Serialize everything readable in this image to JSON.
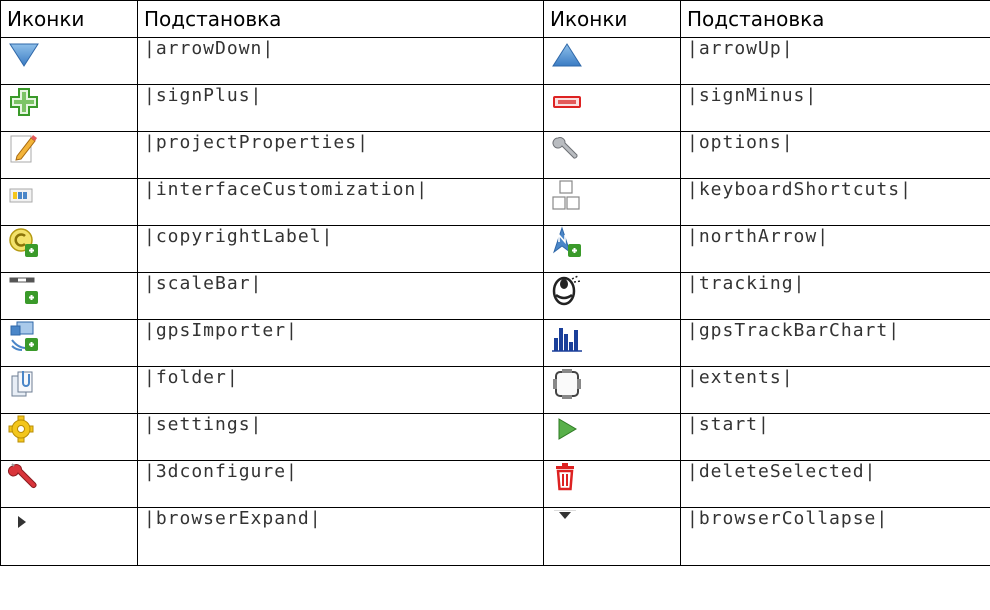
{
  "headers": [
    "Иконки",
    "Подстановка",
    "Иконки",
    "Подстановка"
  ],
  "rows": [
    {
      "left": {
        "icon": "arrow-down-icon",
        "code": "|arrowDown|"
      },
      "right": {
        "icon": "arrow-up-icon",
        "code": "|arrowUp|"
      }
    },
    {
      "left": {
        "icon": "sign-plus-icon",
        "code": "|signPlus|"
      },
      "right": {
        "icon": "sign-minus-icon",
        "code": "|signMinus|"
      }
    },
    {
      "left": {
        "icon": "project-properties-icon",
        "code": "|projectProperties|"
      },
      "right": {
        "icon": "options-icon",
        "code": "|options|"
      }
    },
    {
      "left": {
        "icon": "interface-customization-icon",
        "code": "|interfaceCustomization|"
      },
      "right": {
        "icon": "keyboard-shortcuts-icon",
        "code": "|keyboardShortcuts|"
      }
    },
    {
      "left": {
        "icon": "copyright-label-icon",
        "code": "|copyrightLabel|"
      },
      "right": {
        "icon": "north-arrow-icon",
        "code": "|northArrow|"
      }
    },
    {
      "left": {
        "icon": "scale-bar-icon",
        "code": "|scaleBar|"
      },
      "right": {
        "icon": "tracking-icon",
        "code": "|tracking|"
      }
    },
    {
      "left": {
        "icon": "gps-importer-icon",
        "code": "|gpsImporter|"
      },
      "right": {
        "icon": "gps-track-bar-chart-icon",
        "code": "|gpsTrackBarChart|"
      }
    },
    {
      "left": {
        "icon": "folder-icon",
        "code": "|folder|"
      },
      "right": {
        "icon": "extents-icon",
        "code": "|extents|"
      }
    },
    {
      "left": {
        "icon": "settings-icon",
        "code": "|settings|"
      },
      "right": {
        "icon": "start-icon",
        "code": "|start|"
      }
    },
    {
      "left": {
        "icon": "3d-configure-icon",
        "code": "|3dconfigure|"
      },
      "right": {
        "icon": "delete-selected-icon",
        "code": "|deleteSelected|"
      }
    },
    {
      "left": {
        "icon": "browser-expand-icon",
        "code": "|browserExpand|"
      },
      "right": {
        "icon": "browser-collapse-icon",
        "code": "|browserCollapse|"
      }
    }
  ],
  "colors": {
    "green": "#3a9a2a",
    "blue": "#4a86c8",
    "red": "#d22",
    "yellow": "#f3c61c"
  }
}
